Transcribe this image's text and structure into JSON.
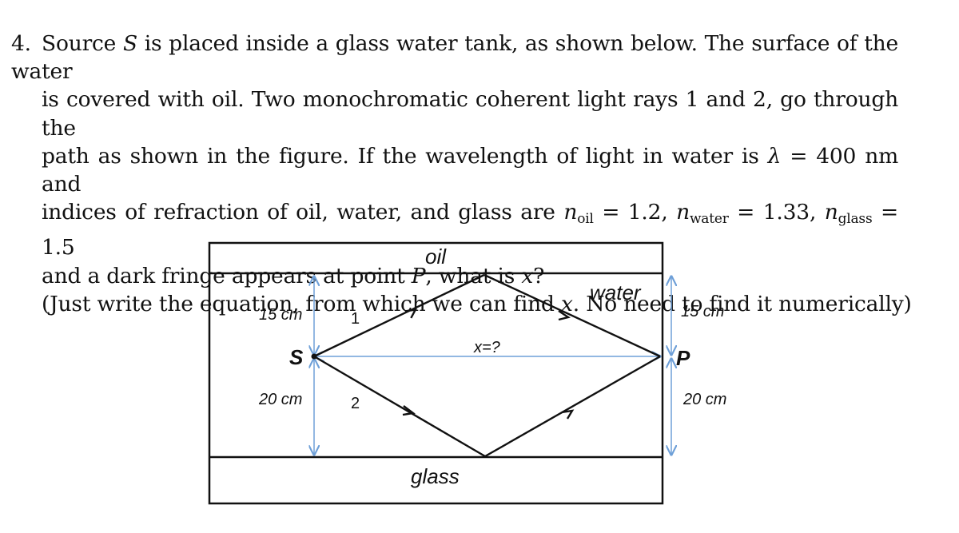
{
  "problem": {
    "number": "4.",
    "lines": [
      [
        "Source ",
        "S",
        " is placed inside a glass water tank, as shown below. The surface of the water"
      ],
      [
        "is covered with oil. Two monochromatic coherent light rays 1 and 2, go through the"
      ],
      [
        "path as shown in the figure. If the wavelength of light in water is ",
        "λ",
        " = 400 nm and"
      ],
      [
        "indices of refraction of oil, water, and glass are "
      ],
      [
        "and a dark fringe appears at point ",
        "P",
        ", what is ",
        "x",
        "?"
      ],
      [
        "(Just write the equation, from which we can find ",
        "x",
        ". No need to find it numerically)"
      ]
    ],
    "indices": {
      "oil": {
        "symbol": "n",
        "sub": "oil",
        "value": "1.2"
      },
      "water": {
        "symbol": "n",
        "sub": "water",
        "value": "1.33"
      },
      "glass": {
        "symbol": "n",
        "sub": "glass",
        "value": "1.5"
      }
    },
    "wavelength": "400 nm"
  },
  "figure": {
    "layers": {
      "oil": "oil",
      "water": "water",
      "glass": "glass"
    },
    "source_label": "S",
    "point_label": "P",
    "ray_labels": {
      "ray1": "1",
      "ray2": "2"
    },
    "distance_label": "x=?",
    "dimensions": {
      "left_top": "15 cm",
      "left_bottom": "20 cm",
      "right_top": "15 cm",
      "right_bottom": "20 cm"
    },
    "colors": {
      "lines": "#111111",
      "dimension": "#6fa0d8"
    }
  }
}
